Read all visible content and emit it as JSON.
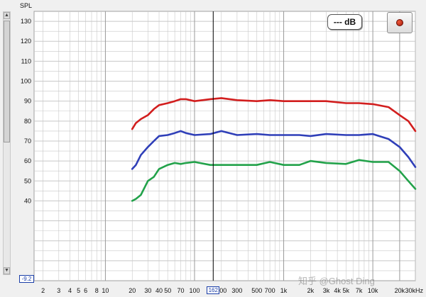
{
  "axis": {
    "y_title": "SPL"
  },
  "controls": {
    "db_readout": "--- dB",
    "offset_value": "-9.2",
    "cursor_value": "162",
    "record_icon": "record-icon"
  },
  "colors": {
    "red": "#d21e1e",
    "blue": "#2f3fb8",
    "green": "#22a24a",
    "grid": "#c8c8c8",
    "cursor": "#000000"
  },
  "watermark": "知乎 @Ghost Ding",
  "chart_data": {
    "type": "line",
    "xscale": "log",
    "xlim": [
      20,
      30000
    ],
    "ylim": [
      0,
      135
    ],
    "y_ticks": [
      40,
      50,
      60,
      70,
      80,
      90,
      100,
      110,
      120,
      130
    ],
    "x_tick_labels": [
      {
        "v": 2,
        "t": "2"
      },
      {
        "v": 3,
        "t": "3"
      },
      {
        "v": 4,
        "t": "4"
      },
      {
        "v": 5,
        "t": "5"
      },
      {
        "v": 6,
        "t": "6"
      },
      {
        "v": 8,
        "t": "8"
      },
      {
        "v": 10,
        "t": "10"
      },
      {
        "v": 20,
        "t": "20"
      },
      {
        "v": 30,
        "t": "30"
      },
      {
        "v": 40,
        "t": "40"
      },
      {
        "v": 50,
        "t": "50"
      },
      {
        "v": 70,
        "t": "70"
      },
      {
        "v": 100,
        "t": "100"
      },
      {
        "v": 200,
        "t": "200"
      },
      {
        "v": 300,
        "t": "300"
      },
      {
        "v": 500,
        "t": "500"
      },
      {
        "v": 700,
        "t": "700"
      },
      {
        "v": 1000,
        "t": "1k"
      },
      {
        "v": 2000,
        "t": "2k"
      },
      {
        "v": 3000,
        "t": "3k"
      },
      {
        "v": 4000,
        "t": "4k"
      },
      {
        "v": 5000,
        "t": "5k"
      },
      {
        "v": 7000,
        "t": "7k"
      },
      {
        "v": 10000,
        "t": "10k"
      },
      {
        "v": 20000,
        "t": "20k"
      },
      {
        "v": 30000,
        "t": "30kHz"
      }
    ],
    "cursor_x": 162,
    "series": [
      {
        "color": "red",
        "x": [
          20,
          22,
          25,
          30,
          35,
          40,
          50,
          60,
          70,
          80,
          100,
          150,
          200,
          300,
          500,
          700,
          1000,
          1500,
          2000,
          3000,
          5000,
          7000,
          10000,
          15000,
          20000,
          25000,
          30000
        ],
        "y": [
          76,
          79,
          81,
          83,
          86,
          88,
          89,
          90,
          91,
          91,
          90,
          91,
          91.5,
          90.5,
          90,
          90.5,
          90,
          90,
          90,
          90,
          89,
          89,
          88.5,
          87,
          83,
          80,
          75
        ]
      },
      {
        "color": "blue",
        "x": [
          20,
          22,
          25,
          30,
          35,
          40,
          50,
          60,
          70,
          80,
          100,
          150,
          200,
          300,
          500,
          700,
          1000,
          1500,
          2000,
          3000,
          5000,
          7000,
          10000,
          15000,
          20000,
          25000,
          30000
        ],
        "y": [
          56,
          58,
          63,
          67,
          70,
          72.5,
          73,
          74,
          75,
          74,
          73,
          73.5,
          75,
          73,
          73.5,
          73,
          73,
          73,
          72.5,
          73.5,
          73,
          73,
          73.5,
          71,
          67,
          62,
          57
        ]
      },
      {
        "color": "green",
        "x": [
          20,
          22,
          25,
          30,
          35,
          40,
          50,
          60,
          70,
          80,
          100,
          150,
          200,
          300,
          500,
          700,
          1000,
          1500,
          2000,
          3000,
          5000,
          7000,
          10000,
          15000,
          20000,
          25000,
          30000
        ],
        "y": [
          40,
          41,
          43,
          50,
          52,
          56,
          58,
          59,
          58.5,
          59,
          59.5,
          58,
          58,
          58,
          58,
          59.5,
          58,
          58,
          60,
          59,
          58.5,
          60.5,
          59.5,
          59.5,
          55,
          50,
          46
        ]
      }
    ]
  }
}
